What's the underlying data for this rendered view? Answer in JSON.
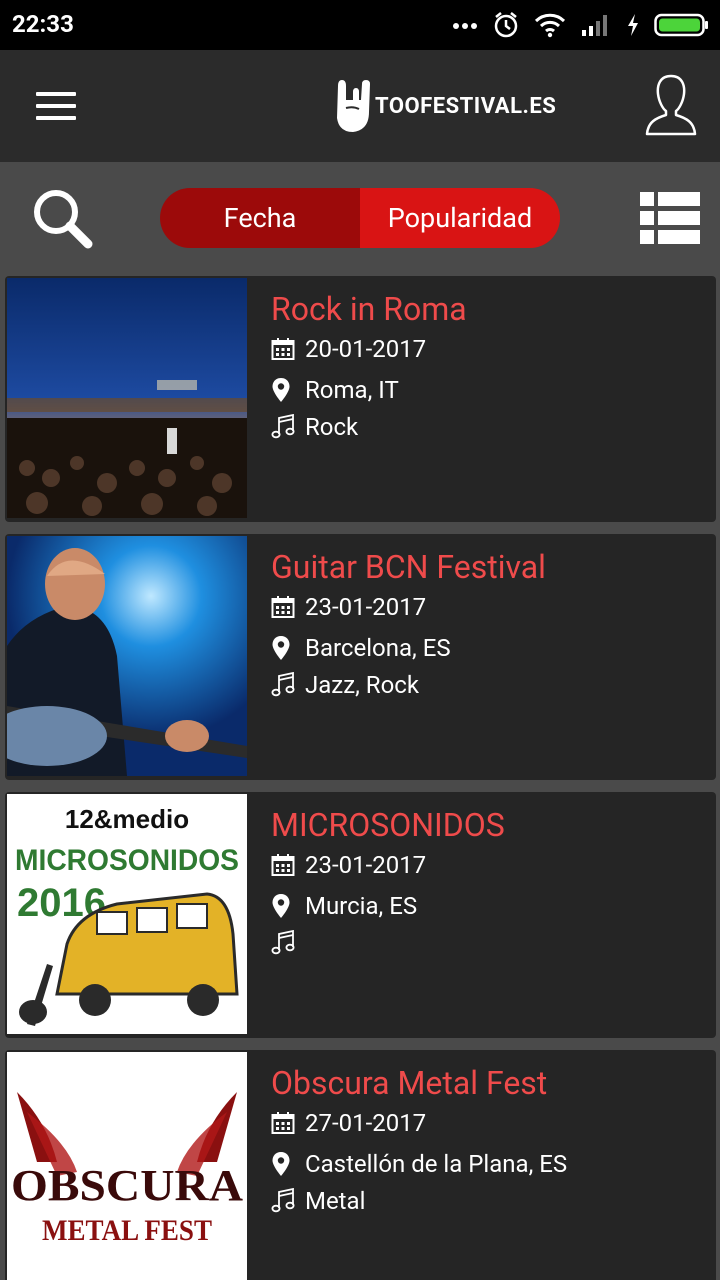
{
  "status_bar": {
    "time": "22:33"
  },
  "header": {
    "brand": "TOOFESTIVAL.ES"
  },
  "toolbar": {
    "sort_date_label": "Fecha",
    "sort_popularity_label": "Popularidad",
    "active_sort": "Popularidad"
  },
  "festivals": [
    {
      "name": "Rock in Roma",
      "date": "20-01-2017",
      "location": "Roma, IT",
      "genres": "Rock",
      "image": "crowd-at-night"
    },
    {
      "name": "Guitar BCN Festival",
      "date": "23-01-2017",
      "location": "Barcelona, ES",
      "genres": "Jazz, Rock",
      "image": "guitarist-on-stage"
    },
    {
      "name": "MICROSONIDOS",
      "date": "23-01-2017",
      "location": "Murcia, ES",
      "genres": "",
      "image": "microsonidos-2016-poster",
      "image_text": [
        "12&medio",
        "MICROSONIDOS",
        "2016"
      ]
    },
    {
      "name": "Obscura Metal Fest",
      "date": "27-01-2017",
      "location": "Castellón de la Plana, ES",
      "genres": "Metal",
      "image": "obscura-metal-fest-logo",
      "image_text": [
        "OBSCURA",
        "METAL FEST"
      ]
    }
  ],
  "colors": {
    "accent": "#ef4b4b",
    "segment_active": "#d91414",
    "segment_inactive": "#9c0a0a",
    "card_bg": "#252525",
    "toolbar_bg": "#4a4a4a",
    "header_bg": "#2b2b2b"
  },
  "icons": {
    "menu": "hamburger-icon",
    "brand": "rock-hand-icon",
    "profile": "user-profile-icon",
    "search": "search-icon",
    "view": "list-view-icon",
    "date": "calendar-icon",
    "location": "map-pin-icon",
    "genre": "music-note-icon"
  }
}
